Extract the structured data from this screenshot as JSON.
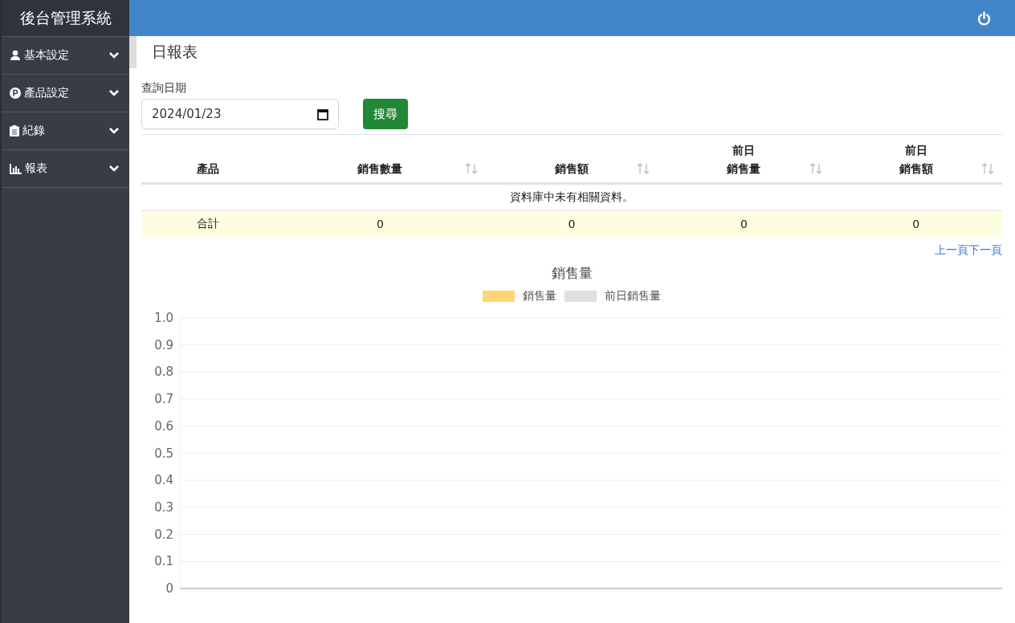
{
  "sidebar": {
    "title": "後台管理系統",
    "items": [
      {
        "label": "基本設定",
        "kind": "user",
        "expanded": false
      },
      {
        "label": "產品設定",
        "kind": "product",
        "expanded": false
      },
      {
        "label": "紀錄",
        "kind": "clipboard",
        "expanded": false
      },
      {
        "label": "報表",
        "kind": "chart",
        "expanded": false
      }
    ]
  },
  "page": {
    "title": "日報表"
  },
  "filter": {
    "label": "查詢日期",
    "value": "2024/01/23",
    "button": "搜尋"
  },
  "table": {
    "columns": [
      {
        "label": [
          "產品"
        ],
        "sortable": false
      },
      {
        "label": [
          "銷售數量"
        ],
        "sortable": true
      },
      {
        "label": [
          "銷售額"
        ],
        "sortable": true
      },
      {
        "label": [
          "前日",
          "銷售量"
        ],
        "sortable": true
      },
      {
        "label": [
          "前日",
          "銷售額"
        ],
        "sortable": true
      }
    ],
    "empty_message": "資料庫中未有相關資料。",
    "total_row": [
      "合計",
      "0",
      "0",
      "0",
      "0"
    ]
  },
  "pagination": {
    "prev": "上一頁",
    "next": "下一頁"
  },
  "chart": {
    "chart_data": {
      "type": "bar",
      "title": "銷售量",
      "series": [
        {
          "name": "銷售量",
          "color": "#ffd676"
        },
        {
          "name": "前日銷售量",
          "color": "#e0e0e0"
        }
      ],
      "ylim": [
        0,
        1
      ],
      "grid": true,
      "yticks": [
        {
          "value": 0,
          "label": "0"
        },
        {
          "value": 0.1,
          "label": "0.1"
        },
        {
          "value": 0.2,
          "label": "0.2"
        },
        {
          "value": 0.3,
          "label": "0.3"
        },
        {
          "value": 0.4,
          "label": "0.4"
        },
        {
          "value": 0.5,
          "label": "0.5"
        },
        {
          "value": 0.6,
          "label": "0.6"
        },
        {
          "value": 0.7,
          "label": "0.7"
        },
        {
          "value": 0.8,
          "label": "0.8"
        },
        {
          "value": 0.9,
          "label": "0.9"
        },
        {
          "value": 1,
          "label": "1.0"
        }
      ]
    }
  }
}
